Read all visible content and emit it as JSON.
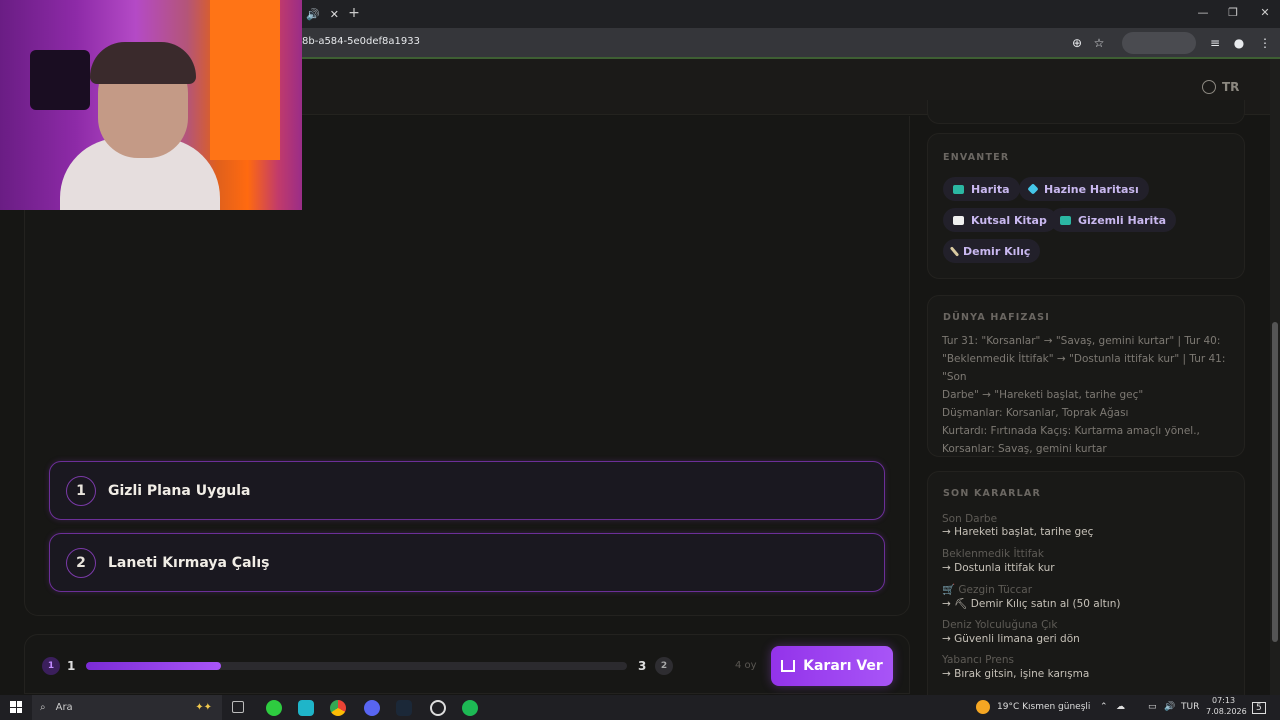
{
  "browser": {
    "url": "8b-a584-5e0def8a1933",
    "tab_audio_icon": "speaker-icon",
    "tab_close": "✕",
    "new_tab": "+"
  },
  "header": {
    "language": "TR"
  },
  "choices": [
    {
      "number": "1",
      "label": "Gizli Plana Uygula"
    },
    {
      "number": "2",
      "label": "Laneti Kırmaya Çalış"
    }
  ],
  "vote": {
    "left_badge": "1",
    "left_count": "1",
    "right_count": "3",
    "right_badge": "2",
    "progress": 0.25,
    "votes_label": "4 oy",
    "button_label": "Kararı Ver"
  },
  "inventory": {
    "title": "ENVANTER",
    "items": [
      {
        "label": "Harita",
        "icon": "map-icon",
        "color": "#2bb7a3"
      },
      {
        "label": "Hazine Haritası",
        "icon": "gem-icon",
        "color": "#45c6e8"
      },
      {
        "label": "Kutsal Kitap",
        "icon": "book-icon",
        "color": "#f0f0f0"
      },
      {
        "label": "Gizemli Harita",
        "icon": "map-icon",
        "color": "#2bb7a3"
      },
      {
        "label": "Demir Kılıç",
        "icon": "sword-icon",
        "color": "#d9c9a0"
      }
    ]
  },
  "world_memory": {
    "title": "DÜNYA HAFIZASI",
    "lines": [
      "Tur 31: \"Korsanlar\" → \"Savaş, gemini kurtar\" | Tur 40:",
      "\"Beklenmedik İttifak\" → \"Dostunla ittifak kur\" | Tur 41: \"Son",
      "Darbe\" → \"Hareketi başlat, tarihe geç\"",
      "Düşmanlar: Korsanlar, Toprak Ağası",
      "Kurtardı: Fırtınada Kaçış: Kurtarma amaçlı yönel.,",
      "Korsanlar: Savaş, gemini kurtar"
    ]
  },
  "recent_decisions": {
    "title": "SON KARARLAR",
    "items": [
      {
        "title": "Son Darbe",
        "choice": "→ Hareketi başlat, tarihe geç"
      },
      {
        "title": "Beklenmedik İttifak",
        "choice": "→ Dostunla ittifak kur"
      },
      {
        "title": "🛒 Gezgin Tüccar",
        "choice": "→ ⛏ Demir Kılıç satın al (50 altın)"
      },
      {
        "title": "Deniz Yolculuğuna Çık",
        "choice": "→ Güvenli limana geri dön"
      },
      {
        "title": "Yabancı Prens",
        "choice": "→ Bırak gitsin, işine karışma"
      }
    ]
  },
  "taskbar": {
    "search_placeholder": "Ara",
    "weather": "19°C  Kısmen güneşli",
    "language": "TUR",
    "time": "07:13",
    "date": "7.08.2026",
    "notifications": "5"
  }
}
